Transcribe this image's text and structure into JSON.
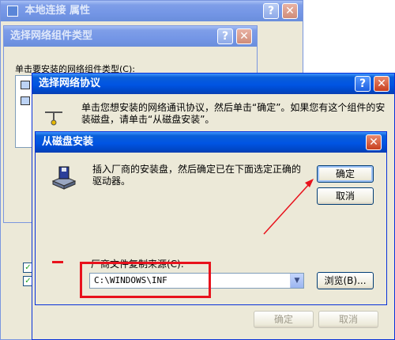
{
  "window1": {
    "title": "本地连接 属性",
    "help": "?",
    "close": "✕"
  },
  "window2": {
    "title": "选择网络组件类型",
    "help": "?",
    "close": "✕",
    "prompt": "单击要安装的网络组件类型(C):"
  },
  "window3": {
    "title": "选择网络协议",
    "help": "?",
    "close": "✕",
    "description": "单击您想安装的网络通讯协议，然后单击“确定”。如果您有这个组件的安装磁盘，请单击“从磁盘安装”。",
    "ok_label": "确定",
    "cancel_label": "取消"
  },
  "dialog": {
    "title": "从磁盘安装",
    "close": "✕",
    "message": "插入厂商的安装盘，然后确定已在下面选定正确的驱动器。",
    "ok_label": "确定",
    "cancel_label": "取消",
    "copy_from_label": "厂商文件复制来源(C):",
    "path_value": "C:\\WINDOWS\\INF",
    "browse_label": "浏览(B)..."
  },
  "colors": {
    "annotation": "#e8121c",
    "title_blue": "#0054e3"
  },
  "icons": [
    "help-icon",
    "close-icon",
    "network-icon",
    "disk-icon",
    "dropdown-arrow-icon",
    "checkbox-icon"
  ]
}
